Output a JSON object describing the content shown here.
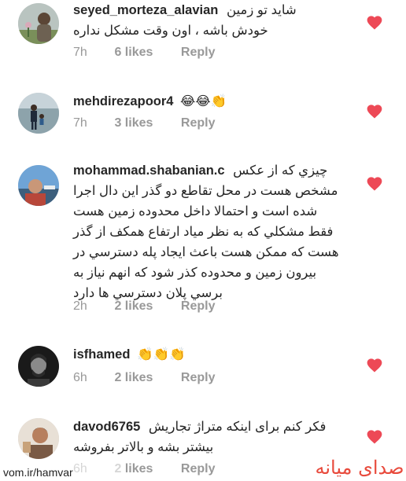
{
  "comments": [
    {
      "username": "seyed_morteza_alavian",
      "lines": [
        "شاید تو زمین",
        "خودش باشه ، اون وقت مشکل نداره"
      ],
      "time": "7h",
      "likes": "6 likes",
      "reply": "Reply"
    },
    {
      "username": "mehdirezapoor4",
      "lines": [
        "😂😂👏"
      ],
      "time": "7h",
      "likes": "3 likes",
      "reply": "Reply"
    },
    {
      "username": "mohammad.shabanian.c",
      "lines": [
        "چيزي كه از عكس",
        "مشخص هست در محل تقاطع دو گذر اين دال اجرا",
        "شده است و احتمالا داخل محدوده زمين هست",
        "فقط مشكلي كه به نظر مياد ارتفاع همكف از گذر",
        "هست كه ممكن هست باعث ايجاد پله دسترسي در",
        "بيرون زمين و محدوده كذر شود كه انهم نياز به",
        "برسي پلان دسترسي ها دارد"
      ],
      "time": "2h",
      "likes": "2 likes",
      "reply": "Reply"
    },
    {
      "username": "isfhamed",
      "lines": [
        "👏👏👏"
      ],
      "time": "6h",
      "likes": "2 likes",
      "reply": "Reply"
    },
    {
      "username": "davod6765",
      "lines": [
        "فکر کنم برای اینکه متراژ تجاریش",
        "بیشتر بشه و بالاتر بفروشه"
      ],
      "time": "6h",
      "likes": "2 likes",
      "reply": "Reply"
    }
  ],
  "watermark": {
    "url": "vom.ir/hamvar",
    "logo": "صدای میانه"
  },
  "colors": {
    "heart": "#ed4956",
    "meta": "#999999",
    "text": "#262626"
  },
  "icons": {
    "like": "heart-icon"
  }
}
